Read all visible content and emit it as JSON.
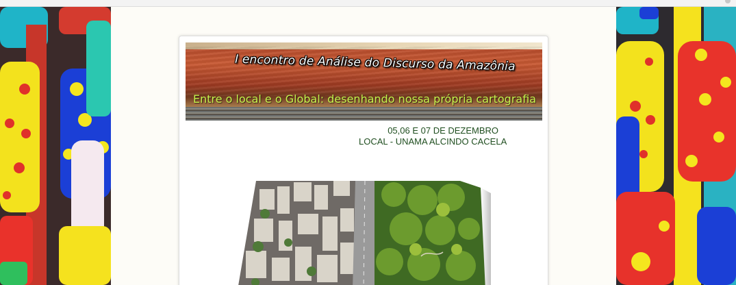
{
  "page": {
    "event_title": "I encontro de Análise do Discurso da Amazônia",
    "event_subtitle": "Entre o local e o Global: desenhando nossa própria cartografia",
    "dates_line": "05,06 E 07 DE DEZEMBRO",
    "location_line": "LOCAL - UNAMA  ALCINDO CACELA"
  },
  "decor": {
    "left_panel_icon": "colorful-toys-image",
    "right_panel_icon": "colorful-toys-image",
    "photo_icon": "city-forest-photo"
  },
  "colors": {
    "background": "#fdfcf7",
    "subtitle": "#c5f24c",
    "info_text": "#1f4e1f",
    "banner_red": "#b44a2c"
  }
}
